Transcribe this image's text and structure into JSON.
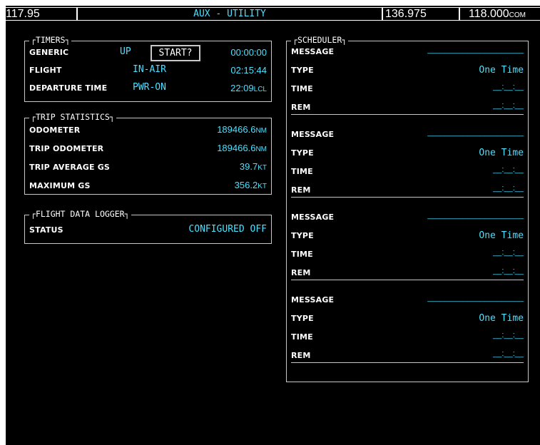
{
  "topbar": {
    "freq_left": "117.95",
    "title": "AUX - UTILITY",
    "freq_com_active": "136.975",
    "freq_com_standby": "118.000",
    "com_label": "COM"
  },
  "timers": {
    "title": "TIMERS",
    "generic": {
      "label": "GENERIC",
      "mode": "UP",
      "button": "START?",
      "time": "00:00:00"
    },
    "flight": {
      "label": "FLIGHT",
      "mode": "IN-AIR",
      "time": "02:15:44"
    },
    "departure": {
      "label": "DEPARTURE TIME",
      "mode": "PWR-ON",
      "time": "22:09",
      "unit": "LCL"
    }
  },
  "trip": {
    "title": "TRIP STATISTICS",
    "odometer": {
      "label": "ODOMETER",
      "value": "189466.6",
      "unit": "NM"
    },
    "trip_odometer": {
      "label": "TRIP ODOMETER",
      "value": "189466.6",
      "unit": "NM"
    },
    "trip_avg_gs": {
      "label": "TRIP AVERAGE GS",
      "value": "39.7",
      "unit": "KT"
    },
    "max_gs": {
      "label": "MAXIMUM GS",
      "value": "356.2",
      "unit": "KT"
    }
  },
  "logger": {
    "title": "FLIGHT DATA LOGGER",
    "status_label": "STATUS",
    "status_value": "CONFIGURED OFF"
  },
  "scheduler": {
    "title": "SCHEDULER",
    "labels": {
      "message": "MESSAGE",
      "type": "TYPE",
      "time": "TIME",
      "rem": "REM"
    },
    "entries": [
      {
        "message": "______________________",
        "type": "One Time",
        "time": "__:__:__",
        "rem": "__:__:__"
      },
      {
        "message": "______________________",
        "type": "One Time",
        "time": "__:__:__",
        "rem": "__:__:__"
      },
      {
        "message": "______________________",
        "type": "One Time",
        "time": "__:__:__",
        "rem": "__:__:__"
      },
      {
        "message": "______________________",
        "type": "One Time",
        "time": "__:__:__",
        "rem": "__:__:__"
      }
    ]
  }
}
